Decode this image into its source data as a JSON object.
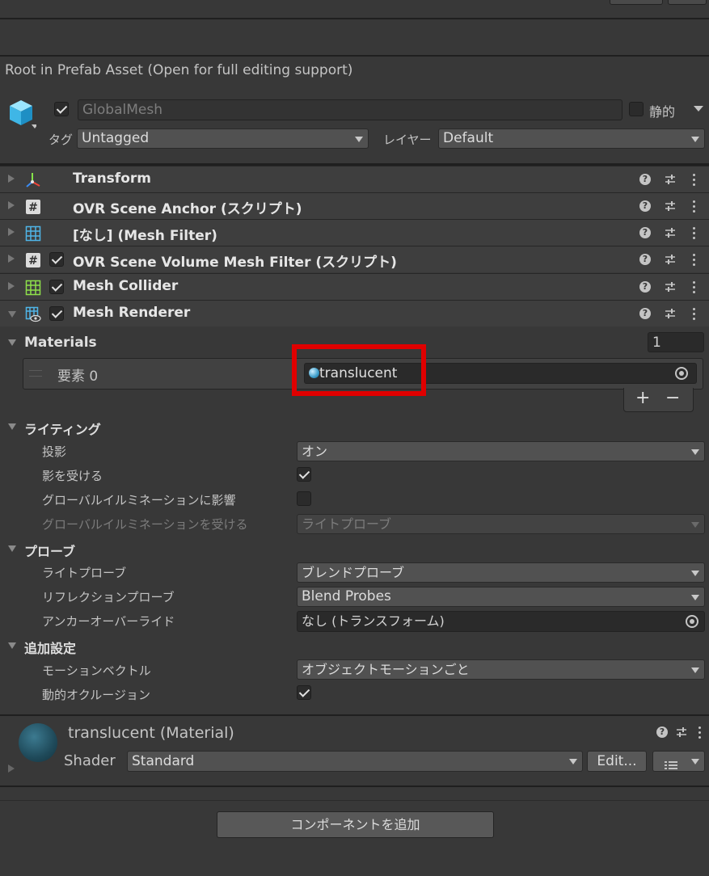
{
  "prefab_notice": "Root in Prefab Asset (Open for full editing support)",
  "gameobject": {
    "name": "GlobalMesh",
    "static_label": "静的",
    "tag_label": "タグ",
    "tag_value": "Untagged",
    "layer_label": "レイヤー",
    "layer_value": "Default"
  },
  "components": [
    {
      "title": "Transform"
    },
    {
      "title": "OVR Scene Anchor (スクリプト)"
    },
    {
      "title": "[なし] (Mesh Filter)"
    },
    {
      "title": "OVR Scene Volume Mesh Filter (スクリプト)"
    },
    {
      "title": "Mesh Collider"
    },
    {
      "title": "Mesh Renderer"
    }
  ],
  "help_glyph": "?",
  "materials": {
    "label": "Materials",
    "count": "1",
    "element_label": "要素 0",
    "element_value": "translucent",
    "plus": "+",
    "minus": "−"
  },
  "lighting": {
    "label": "ライティング",
    "cast_shadows_label": "投影",
    "cast_shadows_value": "オン",
    "receive_shadows_label": "影を受ける",
    "contribute_gi_label": "グローバルイルミネーションに影響",
    "receive_gi_label": "グローバルイルミネーションを受ける",
    "receive_gi_value": "ライトプローブ"
  },
  "probes": {
    "label": "プローブ",
    "light_probes_label": "ライトプローブ",
    "light_probes_value": "ブレンドプローブ",
    "reflection_probes_label": "リフレクションプローブ",
    "reflection_probes_value": "Blend Probes",
    "anchor_override_label": "アンカーオーバーライド",
    "anchor_override_value": "なし (トランスフォーム)"
  },
  "additional": {
    "label": "追加設定",
    "motion_vectors_label": "モーションベクトル",
    "motion_vectors_value": "オブジェクトモーションごと",
    "dynamic_occlusion_label": "動的オクルージョン"
  },
  "material_panel": {
    "title": "translucent (Material)",
    "shader_label": "Shader",
    "shader_value": "Standard",
    "edit_label": "Edit..."
  },
  "add_component_label": "コンポーネントを追加",
  "colors": {
    "highlight": "#e00000",
    "background": "#383838"
  }
}
